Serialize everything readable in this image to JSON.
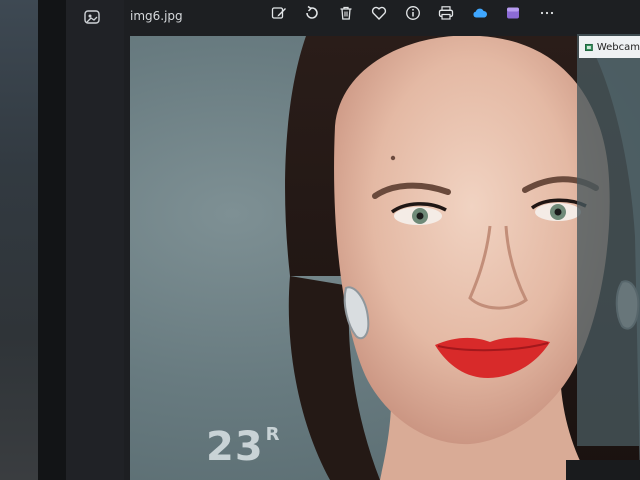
{
  "viewer": {
    "file_name": "img6.jpg",
    "app_icon": "gallery-icon",
    "toolbar": [
      {
        "name": "edit-image-icon",
        "label": ""
      },
      {
        "name": "rotate-icon",
        "label": ""
      },
      {
        "name": "delete-icon",
        "label": ""
      },
      {
        "name": "favorite-heart-icon",
        "label": ""
      },
      {
        "name": "info-icon",
        "label": ""
      },
      {
        "name": "print-icon",
        "label": ""
      },
      {
        "name": "onedrive-cloud-icon",
        "label": ""
      },
      {
        "name": "clipchamp-icon",
        "label": ""
      },
      {
        "name": "more-options-icon",
        "label": ""
      }
    ]
  },
  "photo": {
    "background_text": "23",
    "background_text_suffix": "R"
  },
  "side_panel": {
    "title": "Webcam"
  },
  "colors": {
    "window_bg": "#1d1f22",
    "accent_blue": "#3fa7ff",
    "lips": "#d82a2a"
  }
}
